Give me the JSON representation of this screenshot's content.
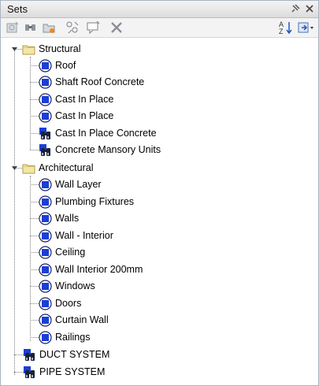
{
  "panel": {
    "title": "Sets"
  },
  "toolbar": {
    "items": [
      {
        "name": "save-selection-icon"
      },
      {
        "name": "save-search-icon"
      },
      {
        "name": "new-folder-icon"
      },
      {
        "name": "duplicate-icon"
      },
      {
        "name": "add-comment-icon"
      },
      {
        "name": "delete-icon"
      },
      {
        "name": "sort-az-icon"
      },
      {
        "name": "import-export-icon"
      }
    ]
  },
  "tree": {
    "groups": [
      {
        "label": "Structural",
        "children": [
          {
            "label": "Roof",
            "kind": "selection"
          },
          {
            "label": "Shaft Roof Concrete",
            "kind": "selection"
          },
          {
            "label": "Cast In Place",
            "kind": "selection"
          },
          {
            "label": "Cast In Place",
            "kind": "selection"
          },
          {
            "label": "Cast In Place Concrete",
            "kind": "search"
          },
          {
            "label": "Concrete Mansory Units",
            "kind": "search"
          }
        ]
      },
      {
        "label": "Architectural",
        "children": [
          {
            "label": "Wall Layer",
            "kind": "selection"
          },
          {
            "label": "Plumbing Fixtures",
            "kind": "selection"
          },
          {
            "label": "Walls",
            "kind": "selection"
          },
          {
            "label": "Wall - Interior",
            "kind": "selection"
          },
          {
            "label": "Ceiling",
            "kind": "selection"
          },
          {
            "label": "Wall Interior 200mm",
            "kind": "selection"
          },
          {
            "label": "Windows",
            "kind": "selection"
          },
          {
            "label": "Doors",
            "kind": "selection"
          },
          {
            "label": "Curtain Wall",
            "kind": "selection"
          },
          {
            "label": "Railings",
            "kind": "selection"
          }
        ]
      }
    ],
    "roots": [
      {
        "label": "DUCT SYSTEM",
        "kind": "search"
      },
      {
        "label": "PIPE SYSTEM",
        "kind": "search"
      }
    ]
  },
  "colors": {
    "accent": "#1a3fd6",
    "folder": "#f3e6a6"
  }
}
